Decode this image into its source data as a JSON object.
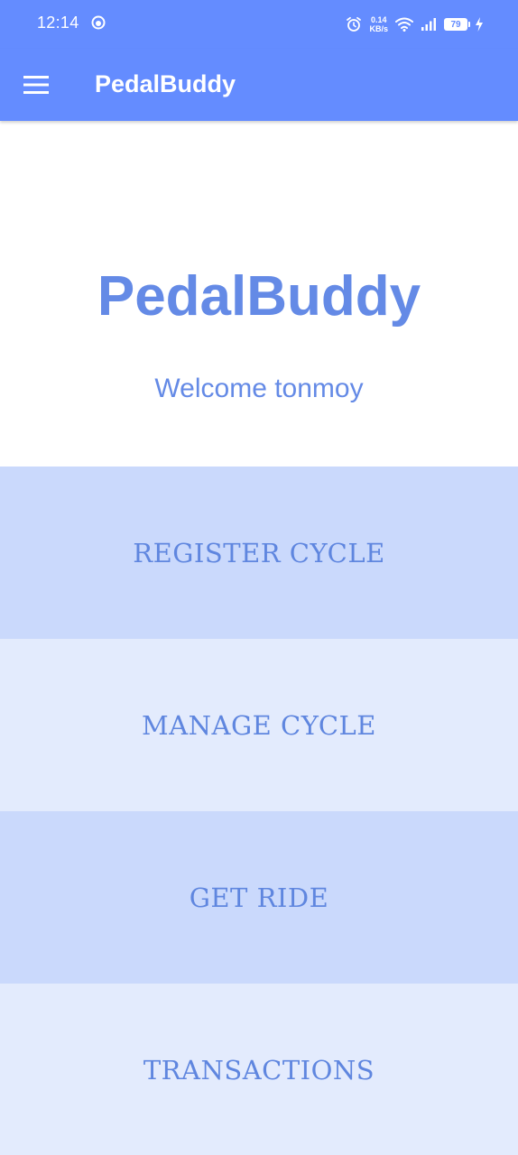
{
  "status_bar": {
    "time": "12:14",
    "net_speed_value": "0.14",
    "net_speed_unit": "KB/s",
    "battery_level": "79",
    "icons": [
      "notification-icon",
      "alarm-icon",
      "wifi-icon",
      "signal-icon",
      "battery-icon",
      "charging-icon"
    ]
  },
  "app_bar": {
    "title": "PedalBuddy",
    "menu_icon": "hamburger-menu-icon"
  },
  "hero": {
    "title": "PedalBuddy",
    "welcome": "Welcome tonmoy"
  },
  "menu": {
    "items": [
      {
        "label": "REGISTER CYCLE"
      },
      {
        "label": "MANAGE CYCLE"
      },
      {
        "label": "GET RIDE"
      },
      {
        "label": "TRANSACTIONS"
      }
    ]
  },
  "colors": {
    "primary": "#648cff",
    "text_accent": "#648ae6",
    "tile_dark": "#cad9fc",
    "tile_light": "#e3ebfd"
  }
}
